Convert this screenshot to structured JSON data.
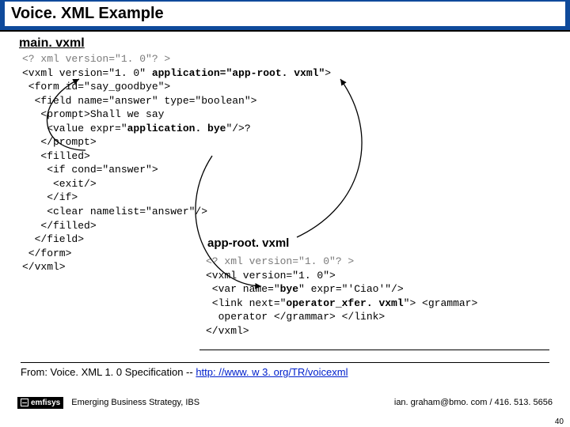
{
  "slide": {
    "title": "Voice. XML Example",
    "file1": "main. vxml",
    "file2": "app-root. vxml",
    "code1_l1": "<? xml version=\"1. 0\"? >",
    "code1_l2a": "<vxml version=\"1. 0\" ",
    "code1_l2b": "application=\"app-root. vxml\"",
    "code1_l2c": ">",
    "code1_l3": " <form id=\"say_goodbye\">",
    "code1_l4": "  <field name=\"answer\" type=\"boolean\">",
    "code1_l5": "   <prompt>Shall we say",
    "code1_l6a": "    <value expr=\"",
    "code1_l6b": "application. bye",
    "code1_l6c": "\"/>?",
    "code1_l7": "   </prompt>",
    "code1_l8": "   <filled>",
    "code1_l9": "    <if cond=\"answer\">",
    "code1_l10": "     <exit/>",
    "code1_l11": "    </if>",
    "code1_l12": "    <clear namelist=\"answer\"/>",
    "code1_l13": "   </filled>",
    "code1_l14": "  </field>",
    "code1_l15": " </form>",
    "code1_l16": "</vxml>",
    "code2_l1": "<? xml version=\"1. 0\"? >",
    "code2_l2": "<vxml version=\"1. 0\">",
    "code2_l3a": " <var name=\"",
    "code2_l3b": "bye",
    "code2_l3c": "\" expr=\"'Ciao'\"/>",
    "code2_l4a": " <link next=\"",
    "code2_l4b": "operator_xfer. vxml",
    "code2_l4c": "\"> <grammar>",
    "code2_l5": "  operator </grammar> </link>",
    "code2_l6": "</vxml>",
    "credit_prefix": "From: Voice. XML 1. 0 Specification --  ",
    "credit_link": "http: //www. w 3. org/TR/voicexml",
    "logo_text": "emfisys",
    "ebs": "Emerging Business Strategy, IBS",
    "contact": "ian. graham@bmo. com / 416. 513. 5656",
    "page": "40"
  }
}
